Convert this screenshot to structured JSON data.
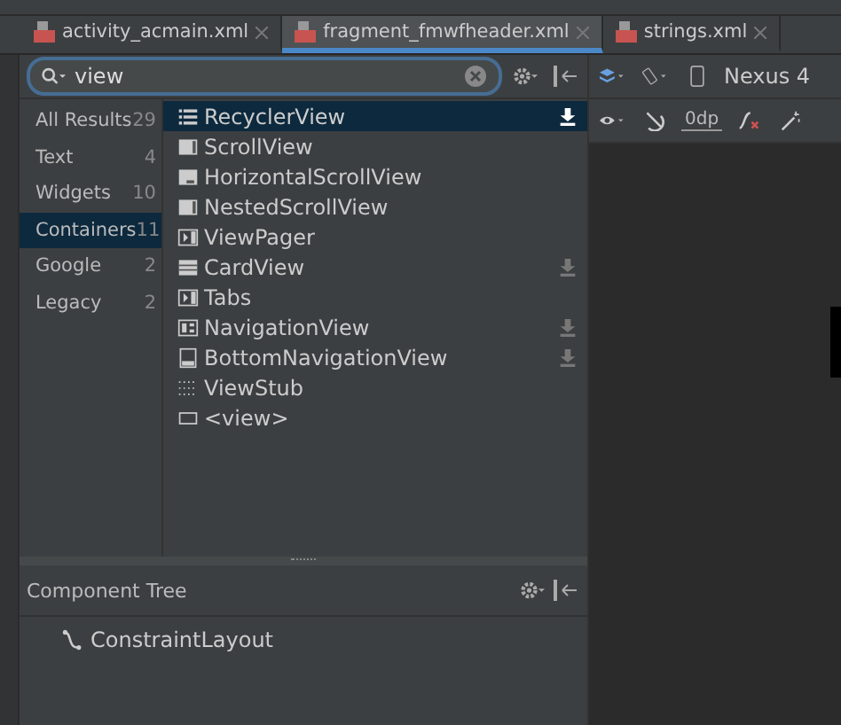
{
  "tabs": [
    {
      "label": "activity_acmain.xml",
      "selected": false
    },
    {
      "label": "fragment_fmwfheader.xml",
      "selected": true
    },
    {
      "label": "strings.xml",
      "selected": false
    }
  ],
  "palette": {
    "search": {
      "value": "view"
    },
    "categories": [
      {
        "label": "All Results",
        "count": "29",
        "selected": false
      },
      {
        "label": "Text",
        "count": "4",
        "selected": false
      },
      {
        "label": "Widgets",
        "count": "10",
        "selected": false
      },
      {
        "label": "Containers",
        "count": "11",
        "selected": true
      },
      {
        "label": "Google",
        "count": "2",
        "selected": false
      },
      {
        "label": "Legacy",
        "count": "2",
        "selected": false
      }
    ],
    "items": [
      {
        "label": "RecyclerView",
        "kind": "list",
        "selected": true,
        "downloadable": true
      },
      {
        "label": "ScrollView",
        "kind": "scroll",
        "selected": false,
        "downloadable": false
      },
      {
        "label": "HorizontalScrollView",
        "kind": "hscroll",
        "selected": false,
        "downloadable": false
      },
      {
        "label": "NestedScrollView",
        "kind": "scroll",
        "selected": false,
        "downloadable": false
      },
      {
        "label": "ViewPager",
        "kind": "pager",
        "selected": false,
        "downloadable": false
      },
      {
        "label": "CardView",
        "kind": "card",
        "selected": false,
        "downloadable": true
      },
      {
        "label": "Tabs",
        "kind": "pager",
        "selected": false,
        "downloadable": false
      },
      {
        "label": "NavigationView",
        "kind": "nav",
        "selected": false,
        "downloadable": true
      },
      {
        "label": "BottomNavigationView",
        "kind": "bottomnav",
        "selected": false,
        "downloadable": true
      },
      {
        "label": "ViewStub",
        "kind": "stub",
        "selected": false,
        "downloadable": false
      },
      {
        "label": "<view>",
        "kind": "view",
        "selected": false,
        "downloadable": false
      }
    ]
  },
  "design_toolbar": {
    "device": "Nexus 4",
    "margin": "0dp"
  },
  "component_tree": {
    "title": "Component Tree",
    "root": "ConstraintLayout"
  }
}
